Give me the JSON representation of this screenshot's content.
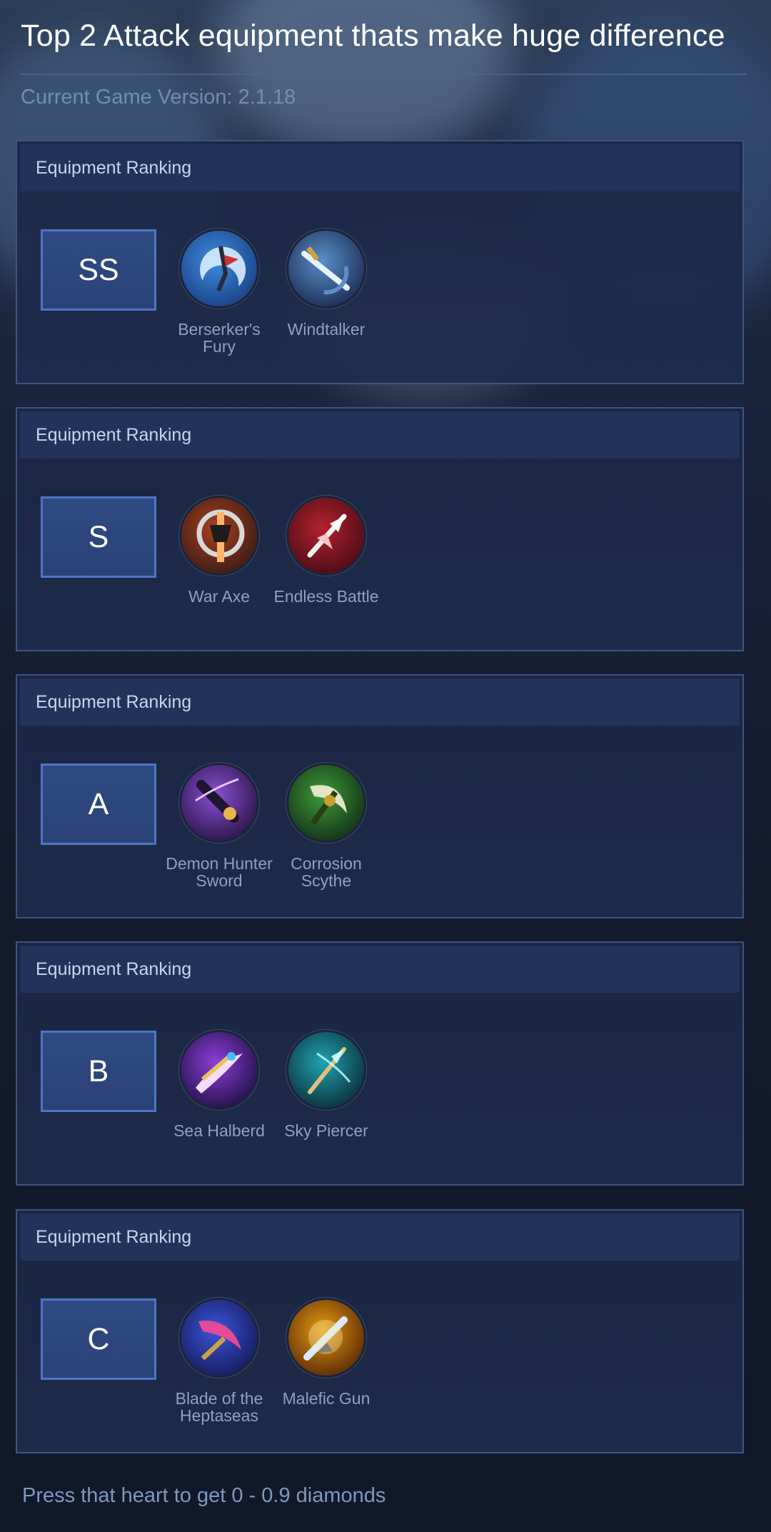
{
  "title": "Top 2 Attack equipment thats make huge difference",
  "version": "Current Game Version: 2.1.18",
  "footer": "Press that heart to get 0 - 0.9 diamonds",
  "tiers": [
    {
      "header": "Equipment Ranking",
      "rank": "SS",
      "items": [
        {
          "name": "Berserker's Fury",
          "icon": "berserkers-fury-icon",
          "colors": [
            "#d9ecff",
            "#3e8fe0",
            "#1a3f86"
          ]
        },
        {
          "name": "Windtalker",
          "icon": "windtalker-icon",
          "colors": [
            "#e6f3ff",
            "#5a8fc7",
            "#1b2e55"
          ]
        }
      ]
    },
    {
      "header": "Equipment Ranking",
      "rank": "S",
      "items": [
        {
          "name": "War Axe",
          "icon": "war-axe-icon",
          "colors": [
            "#ffb36b",
            "#a8421f",
            "#3a1b16"
          ]
        },
        {
          "name": "Endless Battle",
          "icon": "endless-battle-icon",
          "colors": [
            "#ffc4c4",
            "#b3222c",
            "#4a0c16"
          ]
        }
      ]
    },
    {
      "header": "Equipment Ranking",
      "rank": "A",
      "items": [
        {
          "name": "Demon Hunter Sword",
          "icon": "demon-hunter-sword-icon",
          "colors": [
            "#e4c8ff",
            "#8a4fd6",
            "#2a1547"
          ]
        },
        {
          "name": "Corrosion Scythe",
          "icon": "corrosion-scythe-icon",
          "colors": [
            "#c9f2b0",
            "#3f9a3a",
            "#123118"
          ]
        }
      ]
    },
    {
      "header": "Equipment Ranking",
      "rank": "B",
      "items": [
        {
          "name": "Sea Halberd",
          "icon": "sea-halberd-icon",
          "colors": [
            "#f5dcff",
            "#8c3fd8",
            "#221048"
          ]
        },
        {
          "name": "Sky Piercer",
          "icon": "sky-piercer-icon",
          "colors": [
            "#c6ffff",
            "#1fa4b0",
            "#0b2f3a"
          ]
        }
      ]
    },
    {
      "header": "Equipment Ranking",
      "rank": "C",
      "items": [
        {
          "name": "Blade of the Heptaseas",
          "icon": "blade-of-the-heptaseas-icon",
          "colors": [
            "#ffd6f0",
            "#3b55d8",
            "#141c5c"
          ]
        },
        {
          "name": "Malefic Gun",
          "icon": "malefic-gun-icon",
          "colors": [
            "#fff3b0",
            "#e89a12",
            "#5a2a05"
          ]
        }
      ]
    }
  ]
}
